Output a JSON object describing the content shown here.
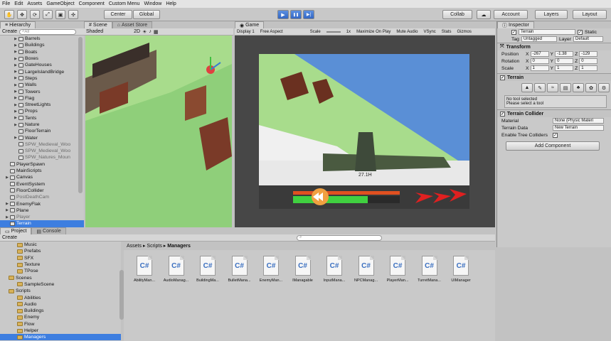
{
  "menu": [
    "File",
    "Edit",
    "Assets",
    "GameObject",
    "Component",
    "Custom Menu",
    "Window",
    "Help"
  ],
  "toolbar": {
    "center": "Center",
    "global": "Global",
    "collab": "Collab",
    "account": "Account",
    "layers": "Layers",
    "layout": "Layout",
    "play": "▶",
    "pause": "❚❚",
    "step": "▶|"
  },
  "hierarchy": {
    "tab": "Hierarchy",
    "create": "Create",
    "search_placeholder": "All",
    "items": [
      {
        "label": "Barrels",
        "indent": 2,
        "arrow": "▶",
        "faded": false
      },
      {
        "label": "Buildings",
        "indent": 2,
        "arrow": "▶",
        "faded": false
      },
      {
        "label": "Boats",
        "indent": 2,
        "arrow": "▶",
        "faded": false
      },
      {
        "label": "Boxes",
        "indent": 2,
        "arrow": "▶",
        "faded": false
      },
      {
        "label": "GateHouses",
        "indent": 2,
        "arrow": "▶",
        "faded": false
      },
      {
        "label": "LargeIslandBridge",
        "indent": 2,
        "arrow": "▶",
        "faded": false
      },
      {
        "label": "Steps",
        "indent": 2,
        "arrow": "▶",
        "faded": false
      },
      {
        "label": "Walls",
        "indent": 2,
        "arrow": "▶",
        "faded": false
      },
      {
        "label": "Towers",
        "indent": 2,
        "arrow": "▶",
        "faded": false
      },
      {
        "label": "Flag",
        "indent": 2,
        "arrow": "▶",
        "faded": false
      },
      {
        "label": "StreetLights",
        "indent": 2,
        "arrow": "▶",
        "faded": false
      },
      {
        "label": "Props",
        "indent": 2,
        "arrow": "▶",
        "faded": false
      },
      {
        "label": "Tents",
        "indent": 2,
        "arrow": "▶",
        "faded": false
      },
      {
        "label": "Nature",
        "indent": 2,
        "arrow": "▶",
        "faded": false
      },
      {
        "label": "FloorTerrain",
        "indent": 2,
        "arrow": "",
        "faded": false
      },
      {
        "label": "Water",
        "indent": 2,
        "arrow": "▶",
        "faded": false
      },
      {
        "label": "SPW_Medieval_Woo",
        "indent": 2,
        "arrow": "",
        "faded": true
      },
      {
        "label": "SPW_Medieval_Woo",
        "indent": 2,
        "arrow": "",
        "faded": true
      },
      {
        "label": "SPW_Natures_Moun",
        "indent": 2,
        "arrow": "",
        "faded": true
      },
      {
        "label": "PlayerSpawn",
        "indent": 1,
        "arrow": "",
        "faded": false
      },
      {
        "label": "MainScripts",
        "indent": 1,
        "arrow": "",
        "faded": false
      },
      {
        "label": "Canvas",
        "indent": 1,
        "arrow": "▶",
        "faded": false
      },
      {
        "label": "EventSystem",
        "indent": 1,
        "arrow": "",
        "faded": false
      },
      {
        "label": "FloorCollider",
        "indent": 1,
        "arrow": "",
        "faded": false
      },
      {
        "label": "PostDeathCam",
        "indent": 1,
        "arrow": "",
        "faded": true
      },
      {
        "label": "EnemyFlak",
        "indent": 1,
        "arrow": "▶",
        "faded": false
      },
      {
        "label": "Plane",
        "indent": 1,
        "arrow": "▶",
        "faded": false
      },
      {
        "label": "Player",
        "indent": 1,
        "arrow": "▶",
        "faded": true
      },
      {
        "label": "Terrain",
        "indent": 1,
        "arrow": "",
        "faded": false,
        "selected": true
      }
    ]
  },
  "scene": {
    "tab": "Scene",
    "tab2": "Asset Store",
    "shaded": "Shaded",
    "mode2d": "2D"
  },
  "game": {
    "tab": "Game",
    "display": "Display 1",
    "aspect": "Free Aspect",
    "scale_label": "Scale",
    "scale_value": "1x",
    "maximize": "Maximize On Play",
    "mute": "Mute Audio",
    "vsync": "VSync",
    "stats": "Stats",
    "gizmos": "Gizmos",
    "hud_number": "27.1H",
    "health_fraction": 0.7
  },
  "inspector": {
    "tab": "Inspector",
    "name": "Terrain",
    "static": "Static",
    "tag_label": "Tag",
    "tag_value": "Untagged",
    "layer_label": "Layer",
    "layer_value": "Default",
    "transform_title": "Transform",
    "position_label": "Position",
    "pos_x": "-267",
    "pos_y": "-1.38",
    "pos_z": "-129",
    "rotation_label": "Rotation",
    "rot_x": "0",
    "rot_y": "0",
    "rot_z": "0",
    "scale_label": "Scale",
    "scl_x": "1",
    "scl_y": "1",
    "scl_z": "1",
    "terrain_title": "Terrain",
    "no_tool": "No tool selected",
    "select_tool": "Please select a tool",
    "collider_title": "Terrain Collider",
    "material_label": "Material",
    "material_value": "None (Physic Materi",
    "terrain_data_label": "Terrain Data",
    "terrain_data_value": "New Terrain",
    "enable_trees": "Enable Tree Colliders",
    "add_component": "Add Component"
  },
  "project": {
    "tab": "Project",
    "tab2": "Console",
    "create": "Create",
    "breadcrumb": [
      "Assets",
      "Scripts",
      "Managers"
    ],
    "folders": [
      {
        "label": "Music",
        "indent": 2
      },
      {
        "label": "Prefabs",
        "indent": 2
      },
      {
        "label": "SFX",
        "indent": 2
      },
      {
        "label": "Texture",
        "indent": 2
      },
      {
        "label": "TPose",
        "indent": 2
      },
      {
        "label": "Scenes",
        "indent": 1
      },
      {
        "label": "SampleScene",
        "indent": 2
      },
      {
        "label": "Scripts",
        "indent": 1
      },
      {
        "label": "Abilities",
        "indent": 2
      },
      {
        "label": "Audio",
        "indent": 2
      },
      {
        "label": "Buildings",
        "indent": 2
      },
      {
        "label": "Enemy",
        "indent": 2
      },
      {
        "label": "Flow",
        "indent": 2
      },
      {
        "label": "Helper",
        "indent": 2
      },
      {
        "label": "Managers",
        "indent": 2,
        "selected": true
      }
    ],
    "assets": [
      "AbilityMan...",
      "AudioManag...",
      "BuildingMa...",
      "BulletMana...",
      "EnemyMan...",
      "IManagable",
      "InputMana...",
      "NPCManag...",
      "PlayerMan...",
      "TurretMana...",
      "UIManager"
    ],
    "cs_label": "C#"
  }
}
